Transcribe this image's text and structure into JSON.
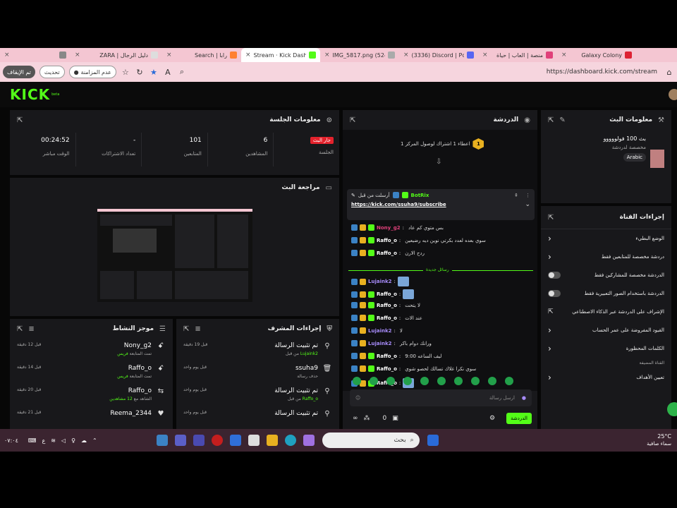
{
  "browser": {
    "tabs": [
      {
        "label": "",
        "fav": "#888",
        "active": false
      },
      {
        "label": "ZARA | دليل الرجال",
        "fav": "#ddd",
        "active": false
      },
      {
        "label": "Search | رابا",
        "fav": "#ff8030",
        "active": false
      },
      {
        "label": "Stream · Kick Dashbo",
        "fav": "#53fc18",
        "active": true
      },
      {
        "label": "IMG_5817.png (524×1",
        "fav": "#aaa",
        "active": false
      },
      {
        "label": "(3336) Discord | Pchat",
        "fav": "#5865f2",
        "active": false
      },
      {
        "label": "منصة | العاب | حياة",
        "fav": "#e0407a",
        "active": false
      },
      {
        "label": "Galaxy Colony",
        "fav": "#d23",
        "active": false
      }
    ],
    "url": "https://dashboard.kick.com/stream",
    "profile_label": "تم الإيقاف",
    "guest_label": "تحديث",
    "account_label": "عدم المزامنة"
  },
  "kick": {
    "logo": "KICK",
    "logo_sup": "beta"
  },
  "session": {
    "title": "معلومات الجلسة",
    "stats": [
      {
        "value": "00:24:52",
        "label": "الوقت مباشر"
      },
      {
        "value": "-",
        "label": "تعداد الاشتراكات"
      },
      {
        "value": "101",
        "label": "المتابعين"
      },
      {
        "value": "6",
        "label": "المشاهدين"
      },
      {
        "value": "جار البث",
        "label": "الجلسة",
        "badge": true
      }
    ]
  },
  "preview": {
    "title": "مراجعة البث"
  },
  "activity": {
    "title": "موجز النشاط",
    "items": [
      {
        "name": "Nony_g2",
        "sub_prefix": "تمت المتابعة",
        "sub_hl": "فريس",
        "time": "قبل 12 دقيقة",
        "icon": "user-plus-icon"
      },
      {
        "name": "Raffo_o",
        "sub_prefix": "تمت المتابعة",
        "sub_hl": "فريس",
        "time": "قبل 14 دقيقة",
        "icon": "user-plus-icon"
      },
      {
        "name": "Raffo_o",
        "sub_prefix": "الشاهد مع",
        "sub_hl": "12 مشاهدين",
        "time": "قبل 20 دقيقة",
        "icon": "host-icon"
      },
      {
        "name": "Reema_2344",
        "sub_prefix": "",
        "sub_hl": "",
        "time": "قبل 21 دقيقة",
        "icon": "heart-icon"
      }
    ]
  },
  "modactions": {
    "title": "إجراءات المشرف",
    "items": [
      {
        "name": "تم تثبيت الرسالة",
        "sub_prefix": "من قبل",
        "sub_hl": "Lujaink2",
        "time": "قبل 19 دقيقة",
        "icon": "pin-icon"
      },
      {
        "name": "ssuha9",
        "sub_prefix": "حذف رسالة",
        "sub_hl": "",
        "time": "قبل يوم واحد",
        "icon": "trash-icon"
      },
      {
        "name": "تم تثبيت الرسالة",
        "sub_prefix": "من قبل",
        "sub_hl": "Raffo_o",
        "time": "قبل يوم واحد",
        "icon": "pin-icon"
      },
      {
        "name": "تم تثبيت الرسالة",
        "sub_prefix": "",
        "sub_hl": "",
        "time": "قبل يوم واحد",
        "icon": "pin-icon"
      }
    ]
  },
  "chat": {
    "title": "الدردشة",
    "goal": "اعطاء 1 اشتراك لوصول المركز 1",
    "goal_num": "1",
    "pinned_by": "أرسلت من قبل",
    "pinned_user": "BotRix",
    "pinned_link": "https://kick.com/ssuha9/subscribe",
    "new_messages": "رسائل جديدة",
    "messages": [
      {
        "user": "Nony_g2",
        "color": "#e0407a",
        "text": "بس متوي كم عاد",
        "emote": false,
        "badges": 3
      },
      {
        "user": "Raffo_o",
        "color": "#ffffff",
        "text": "سوي بعده لعدد بكرتي نوين ديه رضيعين",
        "emote": false,
        "badges": 3
      },
      {
        "user": "Raffo_o",
        "color": "#ffffff",
        "text": "ردح الارن",
        "emote": false,
        "badges": 3
      },
      {
        "user": "Lujaink2",
        "color": "#a78bfa",
        "text": "",
        "emote": true,
        "badges": 2
      },
      {
        "user": "Raffo_o",
        "color": "#ffffff",
        "text": "",
        "emote": true,
        "badges": 3
      },
      {
        "user": "Raffo_o",
        "color": "#ffffff",
        "text": "لا يتحت",
        "emote": false,
        "badges": 3
      },
      {
        "user": "Raffo_o",
        "color": "#ffffff",
        "text": "عند الات",
        "emote": false,
        "badges": 3
      },
      {
        "user": "Lujaink2",
        "color": "#a78bfa",
        "text": "لا",
        "emote": false,
        "badges": 2
      },
      {
        "user": "Lujaink2",
        "color": "#a78bfa",
        "text": "ورانك دوام باكر",
        "emote": false,
        "badges": 2
      },
      {
        "user": "Raffo_o",
        "color": "#ffffff",
        "text": "ليف الساعه 9:00",
        "emote": false,
        "badges": 3
      },
      {
        "user": "Raffo_o",
        "color": "#ffffff",
        "text": "سوي نكرا غلاك تسالك لحصو شوي",
        "emote": false,
        "badges": 3
      },
      {
        "user": "Raffo_o",
        "color": "#ffffff",
        "text": "",
        "emote": true,
        "badges": 3
      }
    ],
    "input_placeholder": "ارسل رسالة",
    "send_label": "الدردشة",
    "footer_count1": "0",
    "footer_count2": "∞"
  },
  "streaminfo": {
    "title": "معلومات البث",
    "stream_title": "بث 100 فولووووو",
    "category": "مخصصة لدردشة",
    "tag": "Arabic"
  },
  "channel": {
    "title": "إجراءات القناة",
    "rows": [
      {
        "label": "الوضع البطيء",
        "ctrl": "chevron"
      },
      {
        "label": "دردشة مخصصة للمتابعين فقط",
        "ctrl": "chevron"
      },
      {
        "label": "الدردشة مخصصة للمشاركين فقط",
        "ctrl": "toggle"
      },
      {
        "label": "الدردشة باستخدام الصور التعبيرية فقط",
        "ctrl": "toggle"
      },
      {
        "label": "الإشراف على الدردشة عبر الذكاء الاصطناعي",
        "ctrl": "ext"
      },
      {
        "label": "القيود المفروضة على عمر الحساب",
        "ctrl": "chevron"
      },
      {
        "label": "الكلمات المحظورة",
        "ctrl": "chevron"
      }
    ],
    "section": "القناة المضيفة",
    "host_row": "تعيين الأهداف"
  },
  "taskbar": {
    "search_placeholder": "بحث",
    "temp": "25°C",
    "weather": "سماء صافية",
    "time": "٠٧:٠٤"
  }
}
